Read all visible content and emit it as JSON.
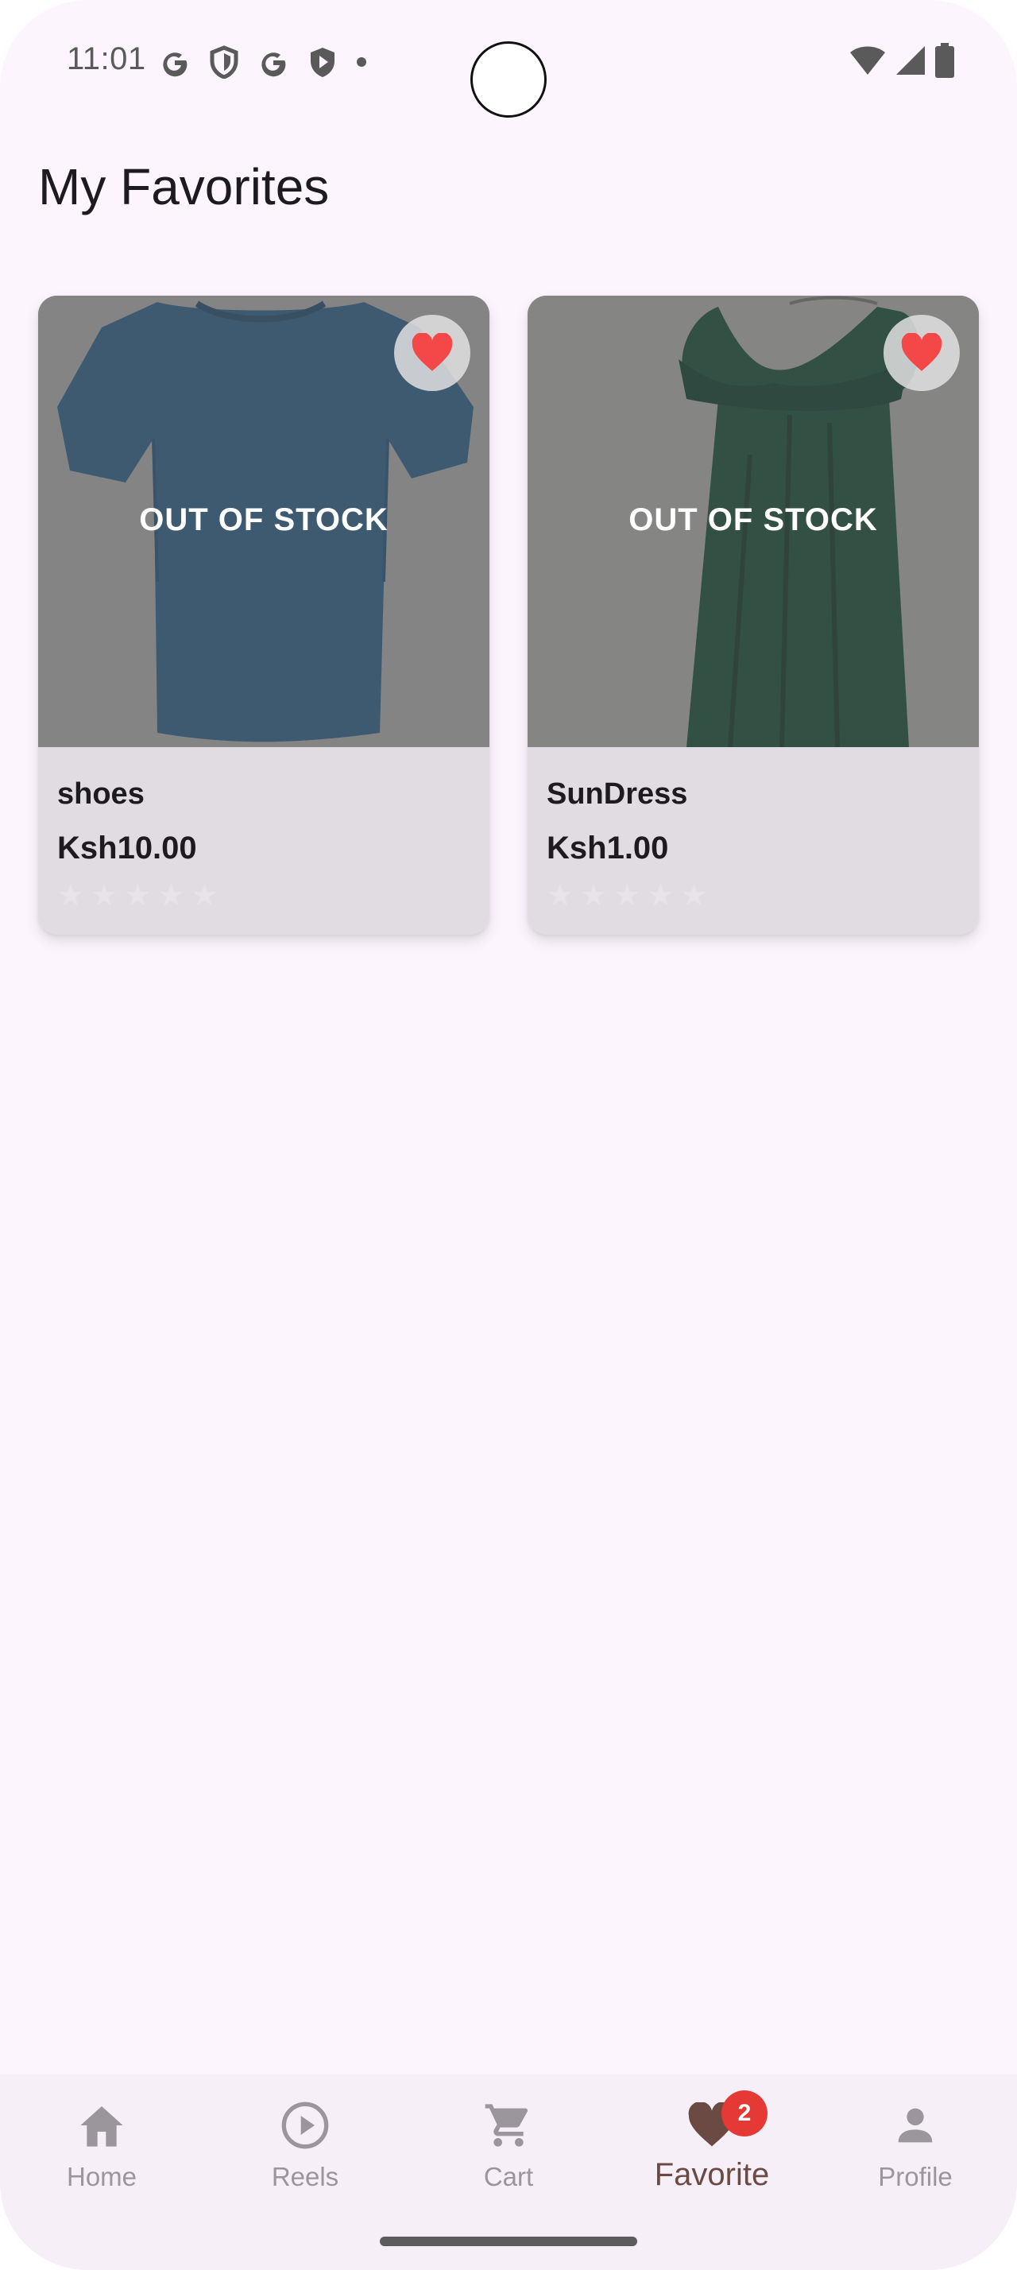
{
  "status_bar": {
    "time": "11:01",
    "left_icons": [
      "google-g-icon",
      "shield-icon",
      "google-g-icon",
      "play-shield-icon",
      "dot-icon"
    ],
    "right_icons": [
      "wifi-icon",
      "signal-icon",
      "battery-icon"
    ]
  },
  "page": {
    "title": "My Favorites"
  },
  "products": [
    {
      "name": "shoes",
      "price": "Ksh10.00",
      "status": "OUT OF STOCK",
      "rating": 0,
      "image": "blue-tshirt",
      "favorite": true
    },
    {
      "name": "SunDress",
      "price": "Ksh1.00",
      "status": "OUT OF STOCK",
      "rating": 0,
      "image": "green-dress",
      "favorite": true
    }
  ],
  "nav": {
    "items": [
      {
        "label": "Home",
        "icon": "home-icon"
      },
      {
        "label": "Reels",
        "icon": "play-circle-icon"
      },
      {
        "label": "Cart",
        "icon": "cart-icon"
      },
      {
        "label": "Favorite",
        "icon": "heart-icon",
        "badge": "2",
        "active": true
      },
      {
        "label": "Profile",
        "icon": "person-icon"
      }
    ]
  },
  "colors": {
    "background": "#fcf5fd",
    "heart": "#f44336",
    "active_nav": "#6b4a44",
    "badge": "#e53935"
  }
}
